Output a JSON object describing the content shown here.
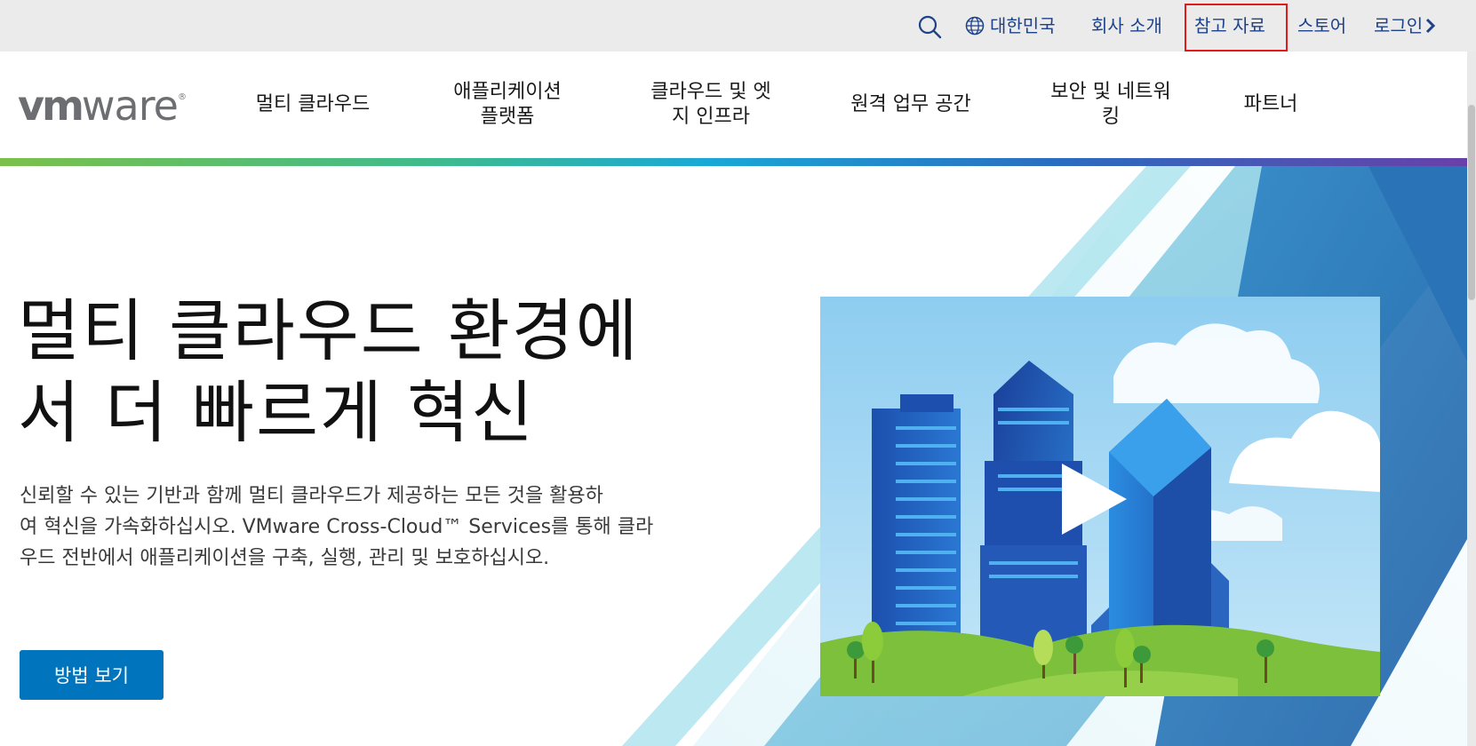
{
  "utility": {
    "region": "대한민국",
    "about": "회사 소개",
    "resources": "참고 자료",
    "store": "스토어",
    "login": "로그인"
  },
  "brand": {
    "logo_bold": "vm",
    "logo_light": "ware",
    "logo_mark": "®"
  },
  "nav": {
    "items": [
      {
        "line1": "멀티 클라우드",
        "line2": ""
      },
      {
        "line1": "애플리케이션",
        "line2": "플랫폼"
      },
      {
        "line1": "클라우드 및 엣",
        "line2": "지 인프라"
      },
      {
        "line1": "원격 업무 공간",
        "line2": ""
      },
      {
        "line1": "보안 및 네트워",
        "line2": "킹"
      },
      {
        "line1": "파트너",
        "line2": ""
      }
    ]
  },
  "hero": {
    "title_line1": "멀티 클라우드 환경에",
    "title_line2": "서 더 빠르게 혁신",
    "description_line1": "신뢰할 수 있는 기반과 함께 멀티 클라우드가 제공하는 모든 것을 활용하",
    "description_line2": "여 혁신을 가속화하십시오. VMware Cross-Cloud™ Services를 통해 클라",
    "description_line3": "우드 전반에서 애플리케이션을 구축, 실행, 관리 및 보호하십시오.",
    "cta_label": "방법 보기"
  },
  "colors": {
    "link": "#1d428a",
    "cta": "#0074bd",
    "highlight": "#e01b1b",
    "sky": "#9fd3f1",
    "tower_dark": "#1f52b8",
    "tower_light": "#2b86d9",
    "grass": "#7cc03b"
  },
  "icons": [
    "search-icon",
    "globe-icon",
    "chevron-right-icon",
    "play-icon"
  ]
}
